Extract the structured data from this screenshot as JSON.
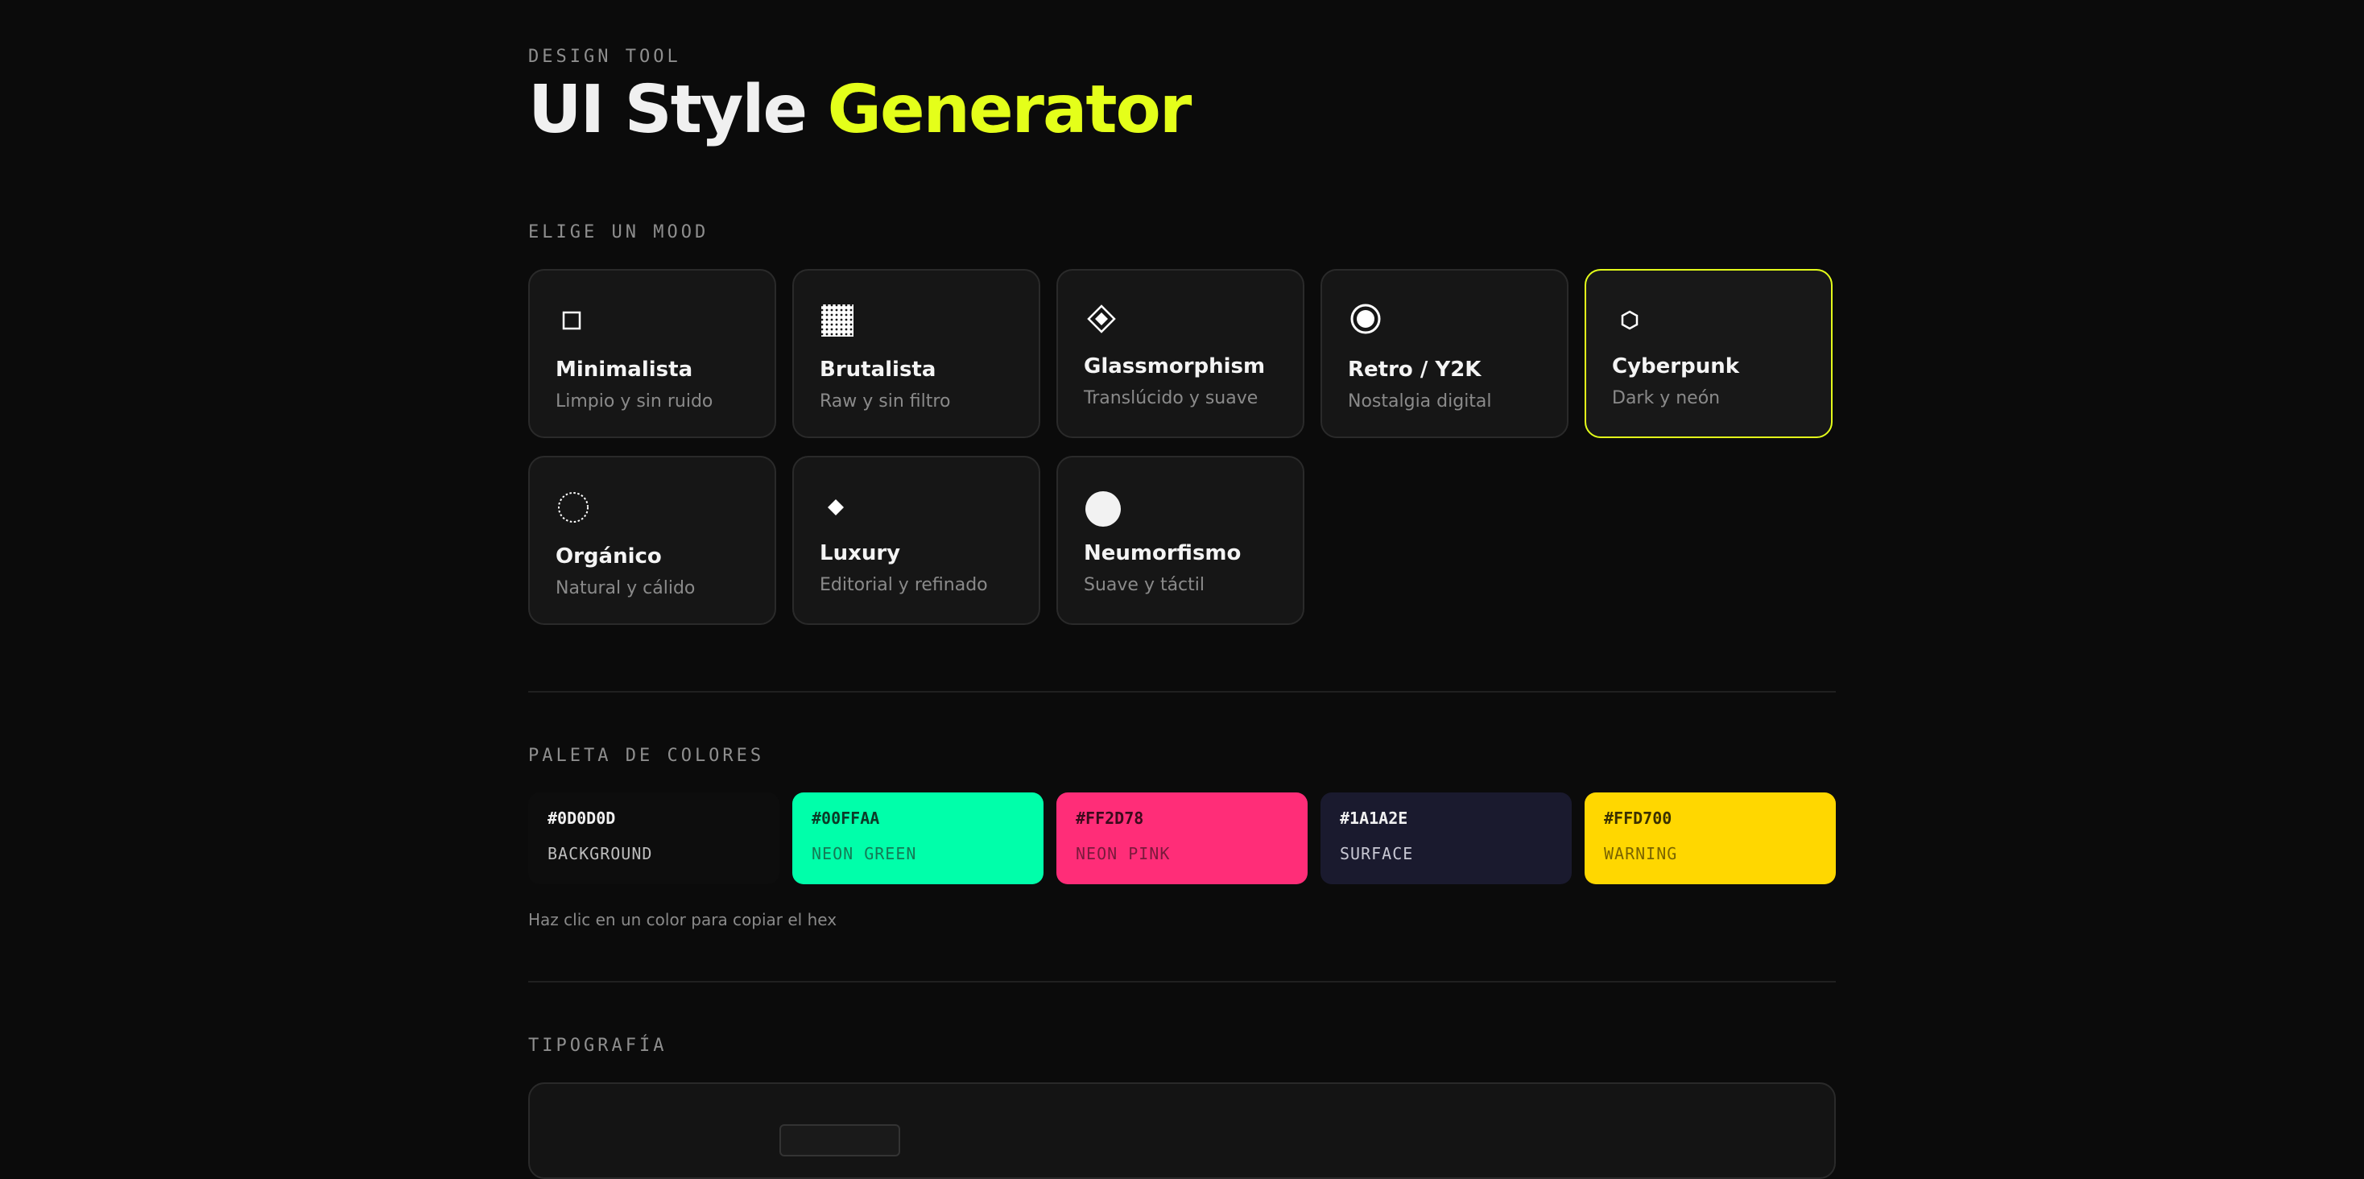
{
  "header": {
    "eyebrow": "DESIGN TOOL",
    "title_part1": "UI Style",
    "title_part2": "Generator",
    "accent_color": "#e4ff1a"
  },
  "moods": {
    "label": "ELIGE UN MOOD",
    "items": [
      {
        "name": "Minimalista",
        "desc": "Limpio y sin ruido",
        "icon": "square-outline-icon"
      },
      {
        "name": "Brutalista",
        "desc": "Raw y sin filtro",
        "icon": "dotted-square-icon"
      },
      {
        "name": "Glassmorphism",
        "desc": "Translúcido y suave",
        "icon": "diamond-icon"
      },
      {
        "name": "Retro / Y2K",
        "desc": "Nostalgia digital",
        "icon": "circle-target-icon"
      },
      {
        "name": "Cyberpunk",
        "desc": "Dark y neón",
        "icon": "hexagon-icon",
        "selected": true
      },
      {
        "name": "Orgánico",
        "desc": "Natural y cálido",
        "icon": "dashed-circle-icon"
      },
      {
        "name": "Luxury",
        "desc": "Editorial y refinado",
        "icon": "small-diamond-icon"
      },
      {
        "name": "Neumorfismo",
        "desc": "Suave y táctil",
        "icon": "filled-circle-icon"
      }
    ]
  },
  "palette": {
    "label": "PALETA DE COLORES",
    "swatches": [
      {
        "hex": "#0D0D0D",
        "name": "BACKGROUND",
        "color": "#0d0d0d",
        "text": "#f0f0f0",
        "subtext": "#bdbdbd"
      },
      {
        "hex": "#00FFAA",
        "name": "NEON GREEN",
        "color": "#00ffaa",
        "text": "#0b3b28",
        "subtext": "#157a55"
      },
      {
        "hex": "#FF2D78",
        "name": "NEON PINK",
        "color": "#ff2d78",
        "text": "#3b0a1c",
        "subtext": "#7a1a3c"
      },
      {
        "hex": "#1A1A2E",
        "name": "SURFACE",
        "color": "#1a1a2e",
        "text": "#f0f0f0",
        "subtext": "#c8c8d4"
      },
      {
        "hex": "#FFD700",
        "name": "WARNING",
        "color": "#ffd700",
        "text": "#3b3100",
        "subtext": "#7a6400"
      }
    ],
    "hint": "Haz clic en un color para copiar el hex"
  },
  "typography": {
    "label": "TIPOGRAFÍA"
  }
}
